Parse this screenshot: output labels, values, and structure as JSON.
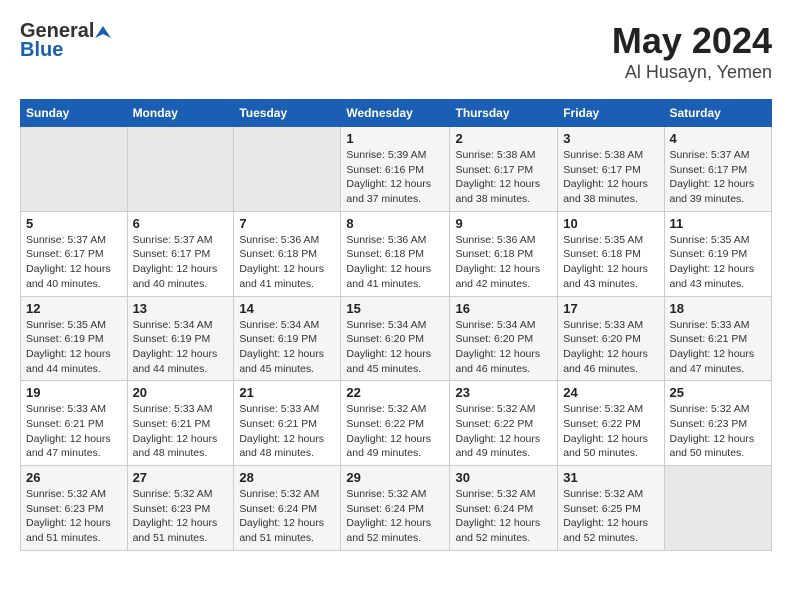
{
  "logo": {
    "general": "General",
    "blue": "Blue"
  },
  "title": "May 2024",
  "subtitle": "Al Husayn, Yemen",
  "days_of_week": [
    "Sunday",
    "Monday",
    "Tuesday",
    "Wednesday",
    "Thursday",
    "Friday",
    "Saturday"
  ],
  "weeks": [
    [
      {
        "day": "",
        "info": ""
      },
      {
        "day": "",
        "info": ""
      },
      {
        "day": "",
        "info": ""
      },
      {
        "day": "1",
        "info": "Sunrise: 5:39 AM\nSunset: 6:16 PM\nDaylight: 12 hours and 37 minutes."
      },
      {
        "day": "2",
        "info": "Sunrise: 5:38 AM\nSunset: 6:17 PM\nDaylight: 12 hours and 38 minutes."
      },
      {
        "day": "3",
        "info": "Sunrise: 5:38 AM\nSunset: 6:17 PM\nDaylight: 12 hours and 38 minutes."
      },
      {
        "day": "4",
        "info": "Sunrise: 5:37 AM\nSunset: 6:17 PM\nDaylight: 12 hours and 39 minutes."
      }
    ],
    [
      {
        "day": "5",
        "info": "Sunrise: 5:37 AM\nSunset: 6:17 PM\nDaylight: 12 hours and 40 minutes."
      },
      {
        "day": "6",
        "info": "Sunrise: 5:37 AM\nSunset: 6:17 PM\nDaylight: 12 hours and 40 minutes."
      },
      {
        "day": "7",
        "info": "Sunrise: 5:36 AM\nSunset: 6:18 PM\nDaylight: 12 hours and 41 minutes."
      },
      {
        "day": "8",
        "info": "Sunrise: 5:36 AM\nSunset: 6:18 PM\nDaylight: 12 hours and 41 minutes."
      },
      {
        "day": "9",
        "info": "Sunrise: 5:36 AM\nSunset: 6:18 PM\nDaylight: 12 hours and 42 minutes."
      },
      {
        "day": "10",
        "info": "Sunrise: 5:35 AM\nSunset: 6:18 PM\nDaylight: 12 hours and 43 minutes."
      },
      {
        "day": "11",
        "info": "Sunrise: 5:35 AM\nSunset: 6:19 PM\nDaylight: 12 hours and 43 minutes."
      }
    ],
    [
      {
        "day": "12",
        "info": "Sunrise: 5:35 AM\nSunset: 6:19 PM\nDaylight: 12 hours and 44 minutes."
      },
      {
        "day": "13",
        "info": "Sunrise: 5:34 AM\nSunset: 6:19 PM\nDaylight: 12 hours and 44 minutes."
      },
      {
        "day": "14",
        "info": "Sunrise: 5:34 AM\nSunset: 6:19 PM\nDaylight: 12 hours and 45 minutes."
      },
      {
        "day": "15",
        "info": "Sunrise: 5:34 AM\nSunset: 6:20 PM\nDaylight: 12 hours and 45 minutes."
      },
      {
        "day": "16",
        "info": "Sunrise: 5:34 AM\nSunset: 6:20 PM\nDaylight: 12 hours and 46 minutes."
      },
      {
        "day": "17",
        "info": "Sunrise: 5:33 AM\nSunset: 6:20 PM\nDaylight: 12 hours and 46 minutes."
      },
      {
        "day": "18",
        "info": "Sunrise: 5:33 AM\nSunset: 6:21 PM\nDaylight: 12 hours and 47 minutes."
      }
    ],
    [
      {
        "day": "19",
        "info": "Sunrise: 5:33 AM\nSunset: 6:21 PM\nDaylight: 12 hours and 47 minutes."
      },
      {
        "day": "20",
        "info": "Sunrise: 5:33 AM\nSunset: 6:21 PM\nDaylight: 12 hours and 48 minutes."
      },
      {
        "day": "21",
        "info": "Sunrise: 5:33 AM\nSunset: 6:21 PM\nDaylight: 12 hours and 48 minutes."
      },
      {
        "day": "22",
        "info": "Sunrise: 5:32 AM\nSunset: 6:22 PM\nDaylight: 12 hours and 49 minutes."
      },
      {
        "day": "23",
        "info": "Sunrise: 5:32 AM\nSunset: 6:22 PM\nDaylight: 12 hours and 49 minutes."
      },
      {
        "day": "24",
        "info": "Sunrise: 5:32 AM\nSunset: 6:22 PM\nDaylight: 12 hours and 50 minutes."
      },
      {
        "day": "25",
        "info": "Sunrise: 5:32 AM\nSunset: 6:23 PM\nDaylight: 12 hours and 50 minutes."
      }
    ],
    [
      {
        "day": "26",
        "info": "Sunrise: 5:32 AM\nSunset: 6:23 PM\nDaylight: 12 hours and 51 minutes."
      },
      {
        "day": "27",
        "info": "Sunrise: 5:32 AM\nSunset: 6:23 PM\nDaylight: 12 hours and 51 minutes."
      },
      {
        "day": "28",
        "info": "Sunrise: 5:32 AM\nSunset: 6:24 PM\nDaylight: 12 hours and 51 minutes."
      },
      {
        "day": "29",
        "info": "Sunrise: 5:32 AM\nSunset: 6:24 PM\nDaylight: 12 hours and 52 minutes."
      },
      {
        "day": "30",
        "info": "Sunrise: 5:32 AM\nSunset: 6:24 PM\nDaylight: 12 hours and 52 minutes."
      },
      {
        "day": "31",
        "info": "Sunrise: 5:32 AM\nSunset: 6:25 PM\nDaylight: 12 hours and 52 minutes."
      },
      {
        "day": "",
        "info": ""
      }
    ]
  ]
}
